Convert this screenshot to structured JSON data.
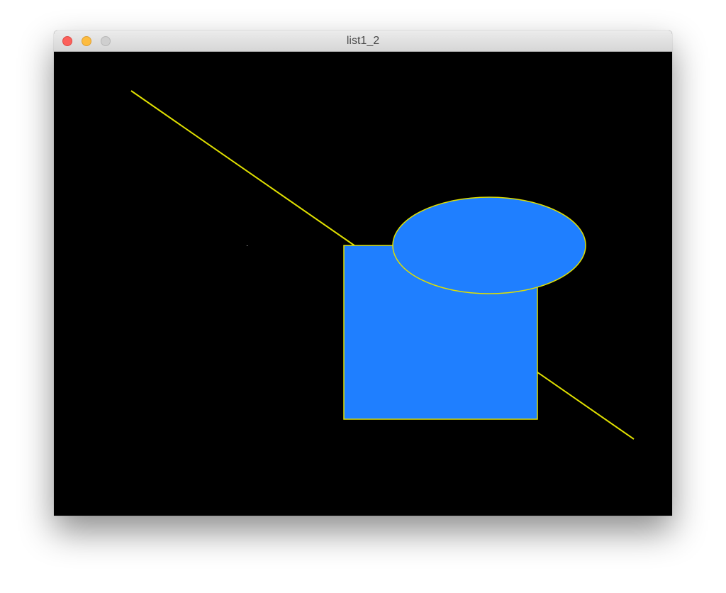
{
  "window": {
    "title": "list1_2",
    "buttons": {
      "close": {
        "color": "#fc605b",
        "border": "#de4a44"
      },
      "minimize": {
        "color": "#fdbc40",
        "border": "#dea032"
      },
      "zoom": {
        "color": "#cfcfcf",
        "border": "#b8b8b8"
      }
    }
  },
  "canvas": {
    "background": "#000000",
    "stroke_color": "#e0e000",
    "fill_color": "#1f7fff"
  }
}
